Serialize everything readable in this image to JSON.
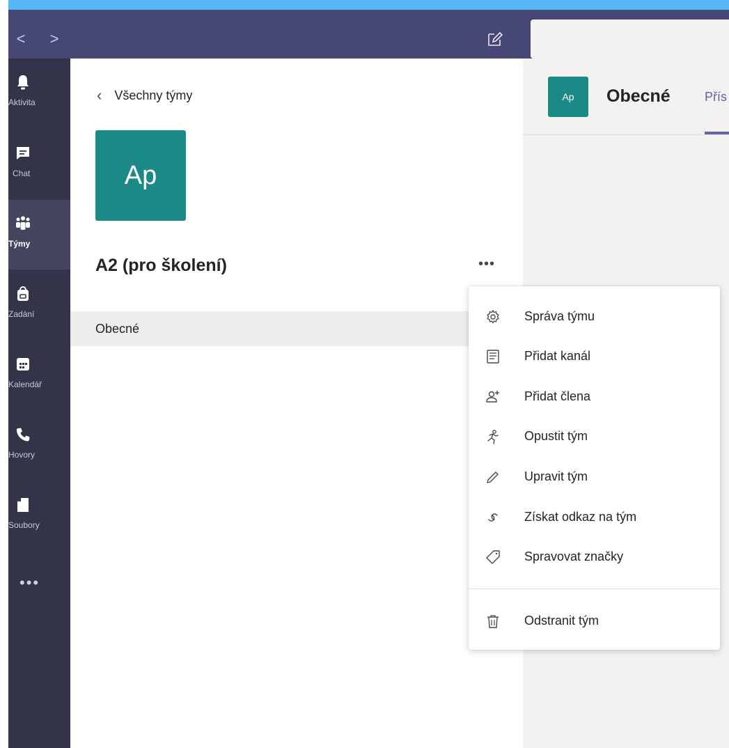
{
  "titlebar": {
    "back_glyph": "<",
    "forward_glyph": ">",
    "compose_icon": "compose-icon"
  },
  "rail": {
    "items": [
      {
        "label": "Aktivita",
        "icon": "bell-icon"
      },
      {
        "label": "Chat",
        "icon": "chat-icon"
      },
      {
        "label": "Týmy",
        "icon": "teams-icon",
        "active": true
      },
      {
        "label": "Zadání",
        "icon": "assignments-icon"
      },
      {
        "label": "Kalendář",
        "icon": "calendar-icon"
      },
      {
        "label": "Hovory",
        "icon": "phone-icon"
      },
      {
        "label": "Soubory",
        "icon": "files-icon"
      }
    ],
    "more": "•••"
  },
  "panel": {
    "back_label": "Všechny týmy",
    "team_initials": "Ap",
    "team_name": "A2 (pro školení)",
    "more_glyph": "•••",
    "channel": "Obecné"
  },
  "content": {
    "avatar_initials": "Ap",
    "channel_title": "Obecné",
    "tab_partial": "Přís"
  },
  "menu": {
    "items": [
      {
        "label": "Správa týmu",
        "icon": "gear-icon"
      },
      {
        "label": "Přidat kanál",
        "icon": "add-channel-icon"
      },
      {
        "label": "Přidat člena",
        "icon": "add-member-icon"
      },
      {
        "label": "Opustit tým",
        "icon": "leave-icon"
      },
      {
        "label": "Upravit tým",
        "icon": "pencil-icon"
      },
      {
        "label": "Získat odkaz na tým",
        "icon": "link-icon"
      },
      {
        "label": "Spravovat značky",
        "icon": "tag-icon"
      }
    ],
    "delete": {
      "label": "Odstranit tým",
      "icon": "trash-icon"
    }
  },
  "colors": {
    "titlebar": "#464775",
    "rail": "#33344a",
    "accent": "#6264a7",
    "team": "#1b8a86"
  }
}
